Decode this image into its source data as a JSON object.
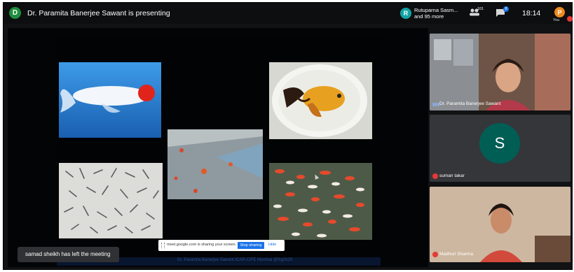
{
  "topbar": {
    "presenter_initial": "D",
    "presenting_text": "Dr. Paramita Banerjee Sawant is presenting",
    "participant_initial": "R",
    "participant_line1": "Rutuparna Sasm...",
    "participant_line2": "and 95 more",
    "people_icon": "people-icon",
    "people_count": "101",
    "chat_icon": "chat-icon",
    "chat_count": "8",
    "time": "18:14",
    "you_initial": "P",
    "you_label": "You"
  },
  "presentation": {
    "footer_text": "Dr. Paramita Banerjee Sawant    ICAR-CIFE Mumbai    @fsg2k20"
  },
  "share_bar": {
    "message": "meet.google.com is sharing your screen.",
    "stop_label": "Stop sharing",
    "hide_label": "Hide"
  },
  "toast": {
    "message": "samad sheikh has left the meeting"
  },
  "tiles": [
    {
      "name": "Dr. Paramita Banerjee Sawant",
      "status_icon": "speaking-icon"
    },
    {
      "name": "suman takar",
      "initial": "S",
      "status_icon": "mic-off-icon"
    },
    {
      "name": "Madhuri Sharma",
      "status_icon": "mic-off-icon"
    }
  ],
  "colors": {
    "accent_blue": "#1a73e8",
    "mic_off_red": "#e53935",
    "avatar_teal": "#005e55"
  }
}
